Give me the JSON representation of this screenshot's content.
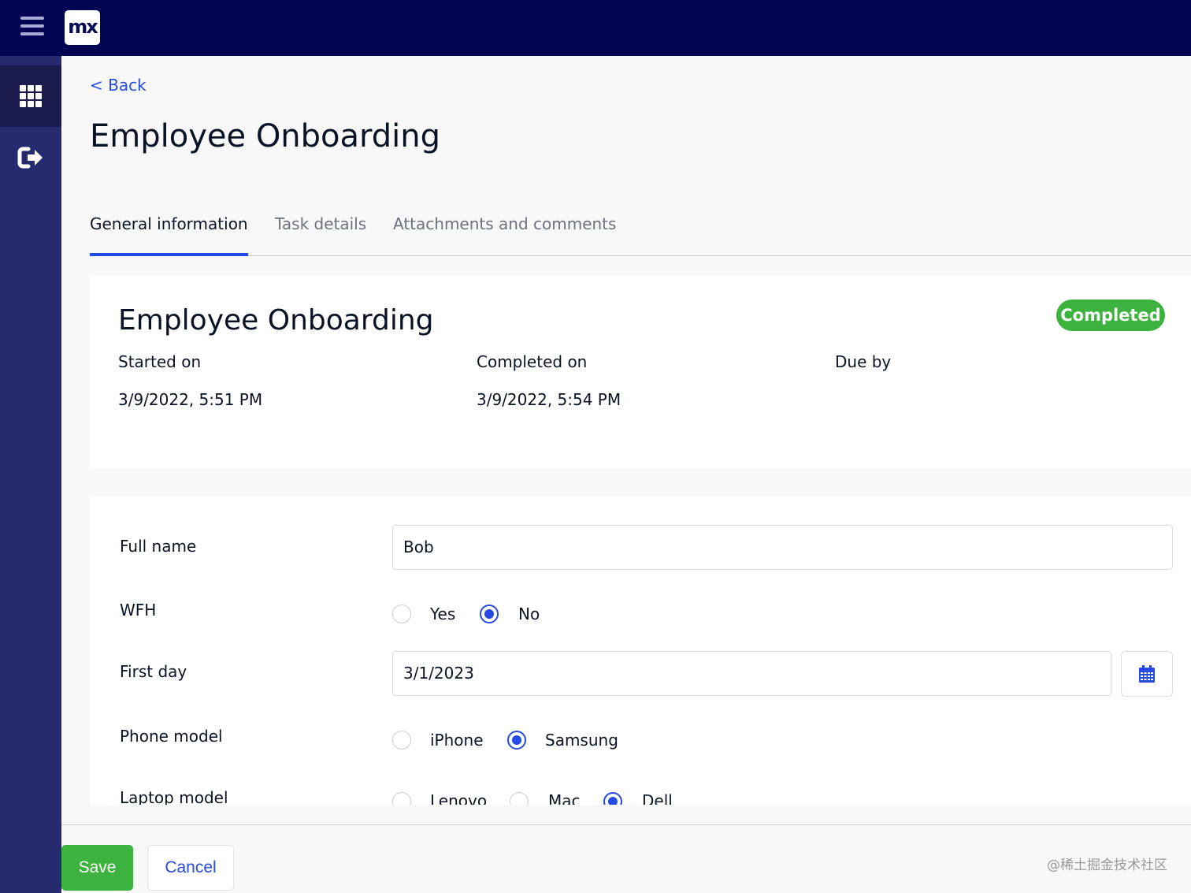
{
  "header": {
    "logo_text": "mx"
  },
  "sidebar": {
    "items": [
      {
        "icon": "apps-grid-icon",
        "active": true
      },
      {
        "icon": "sign-out-icon",
        "active": false
      }
    ]
  },
  "page": {
    "back": "< Back",
    "title": "Employee Onboarding"
  },
  "tabs": [
    {
      "label": "General information",
      "active": true
    },
    {
      "label": "Task details",
      "active": false
    },
    {
      "label": "Attachments and comments",
      "active": false
    }
  ],
  "summary": {
    "title": "Employee Onboarding",
    "status": "Completed",
    "status_color": "#3cb33e",
    "started_label": "Started on",
    "started_value": "3/9/2022, 5:51 PM",
    "completed_label": "Completed on",
    "completed_value": "3/9/2022, 5:54 PM",
    "due_label": "Due by"
  },
  "form": {
    "full_name": {
      "label": "Full name",
      "value": "Bob"
    },
    "wfh": {
      "label": "WFH",
      "options": [
        "Yes",
        "No"
      ],
      "selected": "No"
    },
    "first_day": {
      "label": "First day",
      "value": "3/1/2023"
    },
    "phone": {
      "label": "Phone model",
      "options": [
        "iPhone",
        "Samsung"
      ],
      "selected": "Samsung"
    },
    "laptop": {
      "label": "Laptop model",
      "options": [
        "Lenovo",
        "Mac",
        "Dell"
      ],
      "selected": "Dell"
    }
  },
  "footer": {
    "save": "Save",
    "cancel": "Cancel",
    "watermark": "@稀土掘金技术社区"
  },
  "colors": {
    "accent": "#264ae5",
    "topbar": "#020652",
    "sidebar": "#262a6e"
  }
}
